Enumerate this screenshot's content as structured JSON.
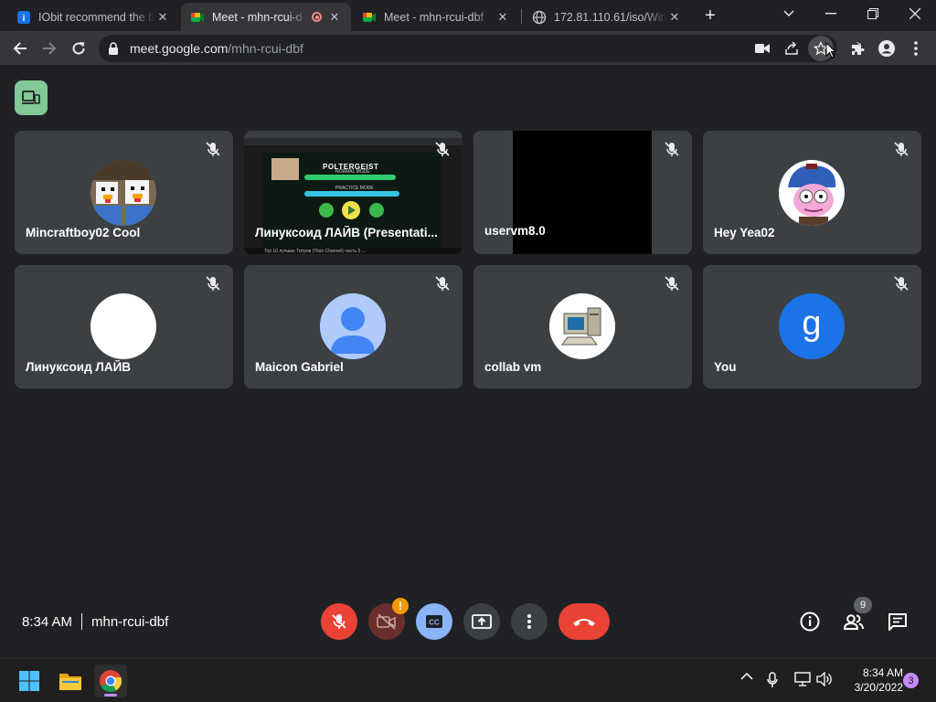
{
  "browser": {
    "tabs": [
      {
        "title": "IObit recommend the b",
        "favicon": "iobit-icon"
      },
      {
        "title": "Meet - mhn-rcui-d",
        "favicon": "meet-icon",
        "recording": true
      },
      {
        "title": "Meet - mhn-rcui-dbf",
        "favicon": "meet-icon"
      },
      {
        "title": "172.81.110.61/iso/Win",
        "favicon": "globe-icon"
      }
    ],
    "new_tab_label": "+",
    "url_host": "meet.google.com",
    "url_path": "/mhn-rcui-dbf"
  },
  "meet": {
    "tiles": [
      {
        "name": "Mincraftboy02 Cool",
        "avatar": "minecraft-avatar",
        "muted": true
      },
      {
        "name": "Линуксоид ЛАЙВ (Presentati...",
        "avatar": "presentation",
        "muted": true
      },
      {
        "name": "uservm8.0",
        "avatar": "black-video",
        "muted": true
      },
      {
        "name": "Hey Yea02",
        "avatar": "cartoon-avatar",
        "muted": true
      },
      {
        "name": "Линуксоид ЛАЙВ",
        "avatar": "white-avatar",
        "muted": true
      },
      {
        "name": "Maicon Gabriel",
        "avatar": "default-person-avatar",
        "muted": true
      },
      {
        "name": "collab vm",
        "avatar": "computer-avatar",
        "muted": true
      },
      {
        "name": "You",
        "avatar": "letter-avatar",
        "initial": "g",
        "muted": true
      }
    ],
    "presentation": {
      "game_title": "POLTERGEIST",
      "normal_mode": "NORMAL MODE",
      "practice_mode": "PRACTICE MODE",
      "caption": "Top 10 лучших Титров (Titan Channel) часть 5 ..."
    },
    "time": "8:34 AM",
    "meeting_code": "mhn-rcui-dbf",
    "camera_warning": "!",
    "participant_count": "9"
  },
  "taskbar": {
    "clock_time": "8:34 AM",
    "clock_date": "3/20/2022",
    "notifications": "3"
  },
  "colors": {
    "background": "#202124",
    "tile": "#3c4043",
    "hangup": "#ea4335",
    "captions": "#8ab4f8",
    "present_chip": "#81c995",
    "user_avatar": "#1a73e8"
  }
}
